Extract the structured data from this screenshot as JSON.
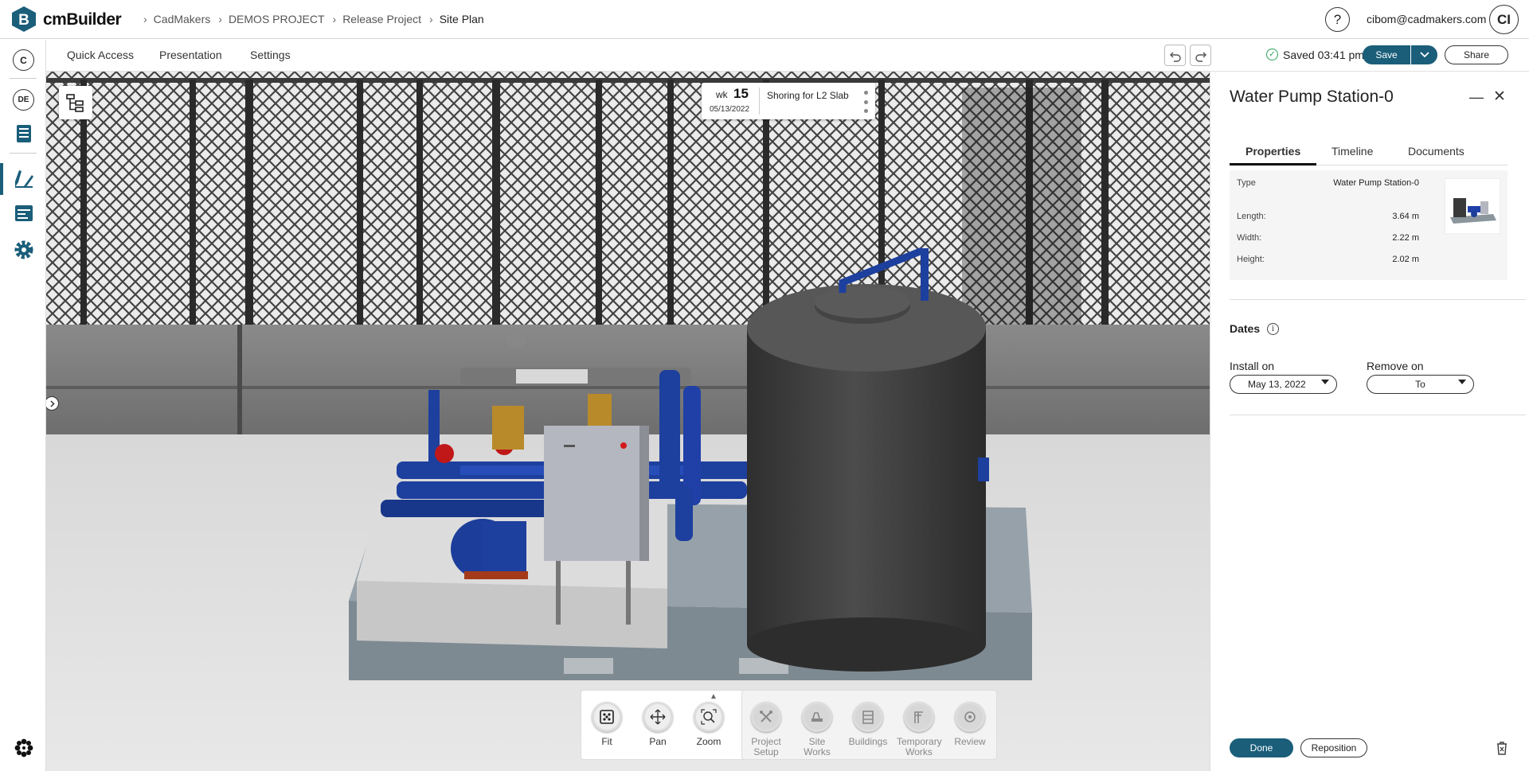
{
  "app": {
    "name": "cmBuilder",
    "logo_letter": "B"
  },
  "breadcrumb": [
    {
      "label": "CadMakers"
    },
    {
      "label": "DEMOS PROJECT"
    },
    {
      "label": "Release Project"
    },
    {
      "label": "Site Plan"
    }
  ],
  "header": {
    "help_label": "?",
    "user_email": "cibom@cadmakers.com",
    "avatar_initials": "CI"
  },
  "rail": {
    "org_initial": "C",
    "lang": "DE"
  },
  "menu": {
    "quick_access": "Quick Access",
    "presentation": "Presentation",
    "settings": "Settings"
  },
  "status": {
    "saved_text": "Saved 03:41 pm"
  },
  "actions": {
    "save_label": "Save",
    "share_label": "Share"
  },
  "schedule": {
    "week_label": "wk",
    "week_number": "15",
    "date": "05/13/2022",
    "task": "Shoring for L2 Slab"
  },
  "nav_tools": [
    {
      "label": "Fit",
      "icon": "fit-icon"
    },
    {
      "label": "Pan",
      "icon": "pan-icon"
    },
    {
      "label": "Zoom",
      "icon": "zoom-icon"
    }
  ],
  "categories": [
    {
      "label": "Project Setup",
      "icon": "project-setup-icon"
    },
    {
      "label": "Site Works",
      "icon": "site-works-icon"
    },
    {
      "label": "Buildings",
      "icon": "buildings-icon"
    },
    {
      "label": "Temporary Works",
      "icon": "temporary-works-icon"
    },
    {
      "label": "Review",
      "icon": "review-icon"
    }
  ],
  "panel": {
    "title": "Water Pump Station-0",
    "tabs": [
      "Properties",
      "Timeline",
      "Documents"
    ],
    "properties": {
      "type_label": "Type",
      "type_value": "Water Pump Station-0",
      "length_label": "Length:",
      "length_value": "3.64 m",
      "width_label": "Width:",
      "width_value": "2.22 m",
      "height_label": "Height:",
      "height_value": "2.02 m"
    },
    "dates": {
      "title": "Dates",
      "install_label": "Install on",
      "install_value": "May 13, 2022",
      "remove_label": "Remove on",
      "remove_value": "To"
    },
    "done_label": "Done",
    "reposition_label": "Reposition"
  },
  "colors": {
    "brand": "#1a5e7a",
    "success": "#2aa55a"
  }
}
